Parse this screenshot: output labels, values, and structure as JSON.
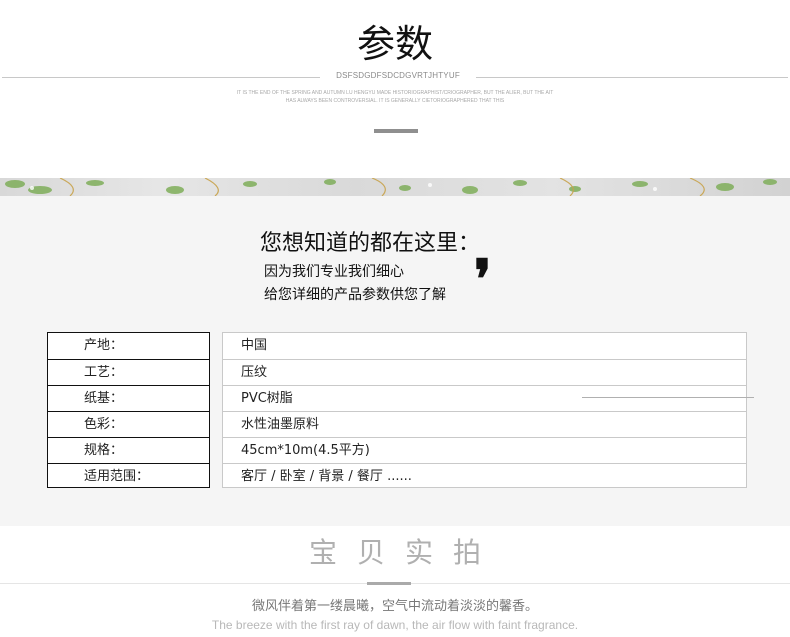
{
  "header": {
    "title": "参数",
    "code": "DSFSDGDFSDCDGVRTJHTYUF",
    "small_line_1": "IT IS THE END OF THE SPRING AND AUTUMN LU HENGYU MADE HISTORIOGRAPHIST/CRIOGRAPHER, BUT THE ALIER, BUT THE AIT",
    "small_line_2": "HAS ALWAYS BEEN CONTROVERSIAL. IT IS GENERALLY CIETORIOGRAPHERED THAT THIS"
  },
  "intro": {
    "title": "您想知道的都在这里：",
    "line_1": "因为我们专业我们细心",
    "line_2": "给您详细的产品参数供您了解",
    "quote_mark": "❜"
  },
  "specs": [
    {
      "label": "产地：",
      "value": "中国"
    },
    {
      "label": "工艺：",
      "value": "压纹"
    },
    {
      "label": "纸基：",
      "value": "PVC树脂"
    },
    {
      "label": "色彩：",
      "value": "水性油墨原料"
    },
    {
      "label": "规格：",
      "value": "45cm*10m(4.5平方)"
    },
    {
      "label": "适用范围：",
      "value": "客厅 / 卧室 / 背景 / 餐厅 ......"
    }
  ],
  "bottom": {
    "title": "宝贝实拍",
    "cn_text": "微风伴着第一缕晨曦，空气中流动着淡淡的馨香。",
    "en_text": "The breeze with the first ray of dawn, the air flow with faint fragrance."
  },
  "colors": {
    "panel_bg": "#f5f5f5",
    "table_border_label": "#111111",
    "table_border_value": "#c9c9c9",
    "strip_leaf": "#7fae5a",
    "strip_gold": "#c8a24a"
  }
}
